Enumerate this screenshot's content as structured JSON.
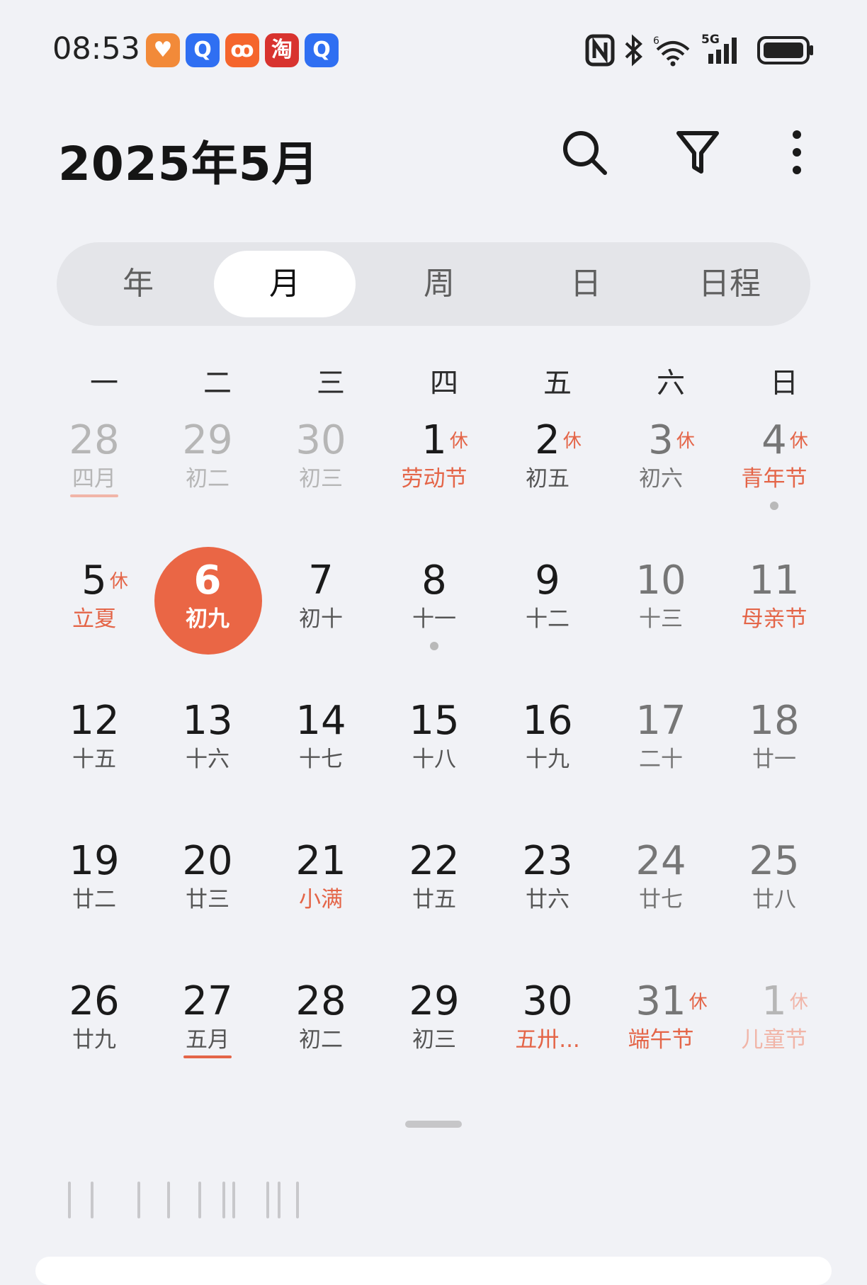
{
  "status_bar": {
    "time": "08:53",
    "apps": [
      {
        "name": "health-app-icon",
        "color": "#f28a39",
        "glyph": "♥"
      },
      {
        "name": "baidu-search-app-icon",
        "color": "#2f6ff2",
        "glyph": "Q"
      },
      {
        "name": "kuaishou-app-icon",
        "color": "#f5652c",
        "glyph": "ꝏ"
      },
      {
        "name": "taobao-app-icon",
        "color": "#d8332f",
        "glyph": "淘"
      },
      {
        "name": "baidu-search-app-icon-2",
        "color": "#2f6ff2",
        "glyph": "Q"
      }
    ],
    "network_label": "5G"
  },
  "header": {
    "title": "2025年5月"
  },
  "view_tabs": [
    {
      "label": "年",
      "active": false
    },
    {
      "label": "月",
      "active": true
    },
    {
      "label": "周",
      "active": false
    },
    {
      "label": "日",
      "active": false
    },
    {
      "label": "日程",
      "active": false
    }
  ],
  "weekdays": [
    "一",
    "二",
    "三",
    "四",
    "五",
    "六",
    "日"
  ],
  "rest_label": "休",
  "accent_color": "#ea6645",
  "weeks": [
    [
      {
        "day": "28",
        "lunar": "四月",
        "other": true,
        "underline": true
      },
      {
        "day": "29",
        "lunar": "初二",
        "other": true
      },
      {
        "day": "30",
        "lunar": "初三",
        "other": true
      },
      {
        "day": "1",
        "lunar": "劳动节",
        "rest": true,
        "red": true
      },
      {
        "day": "2",
        "lunar": "初五",
        "rest": true
      },
      {
        "day": "3",
        "lunar": "初六",
        "rest": true,
        "weekend": true
      },
      {
        "day": "4",
        "lunar": "青年节",
        "rest": true,
        "red": true,
        "weekend": true,
        "dot": true
      }
    ],
    [
      {
        "day": "5",
        "lunar": "立夏",
        "rest": true,
        "red": true
      },
      {
        "day": "6",
        "lunar": "初九",
        "today": true
      },
      {
        "day": "7",
        "lunar": "初十"
      },
      {
        "day": "8",
        "lunar": "十一",
        "dot": true
      },
      {
        "day": "9",
        "lunar": "十二"
      },
      {
        "day": "10",
        "lunar": "十三",
        "weekend": true
      },
      {
        "day": "11",
        "lunar": "母亲节",
        "red": true,
        "weekend": true
      }
    ],
    [
      {
        "day": "12",
        "lunar": "十五"
      },
      {
        "day": "13",
        "lunar": "十六"
      },
      {
        "day": "14",
        "lunar": "十七"
      },
      {
        "day": "15",
        "lunar": "十八"
      },
      {
        "day": "16",
        "lunar": "十九"
      },
      {
        "day": "17",
        "lunar": "二十",
        "weekend": true
      },
      {
        "day": "18",
        "lunar": "廿一",
        "weekend": true
      }
    ],
    [
      {
        "day": "19",
        "lunar": "廿二"
      },
      {
        "day": "20",
        "lunar": "廿三"
      },
      {
        "day": "21",
        "lunar": "小满",
        "red": true
      },
      {
        "day": "22",
        "lunar": "廿五"
      },
      {
        "day": "23",
        "lunar": "廿六"
      },
      {
        "day": "24",
        "lunar": "廿七",
        "weekend": true
      },
      {
        "day": "25",
        "lunar": "廿八",
        "weekend": true
      }
    ],
    [
      {
        "day": "26",
        "lunar": "廿九"
      },
      {
        "day": "27",
        "lunar": "五月",
        "underline": true
      },
      {
        "day": "28",
        "lunar": "初二"
      },
      {
        "day": "29",
        "lunar": "初三"
      },
      {
        "day": "30",
        "lunar": "五卅...",
        "red": true
      },
      {
        "day": "31",
        "lunar": "端午节",
        "rest": true,
        "red": true,
        "weekend": true
      },
      {
        "day": "1",
        "lunar": "儿童节",
        "rest": true,
        "red": true,
        "other": true
      }
    ]
  ]
}
